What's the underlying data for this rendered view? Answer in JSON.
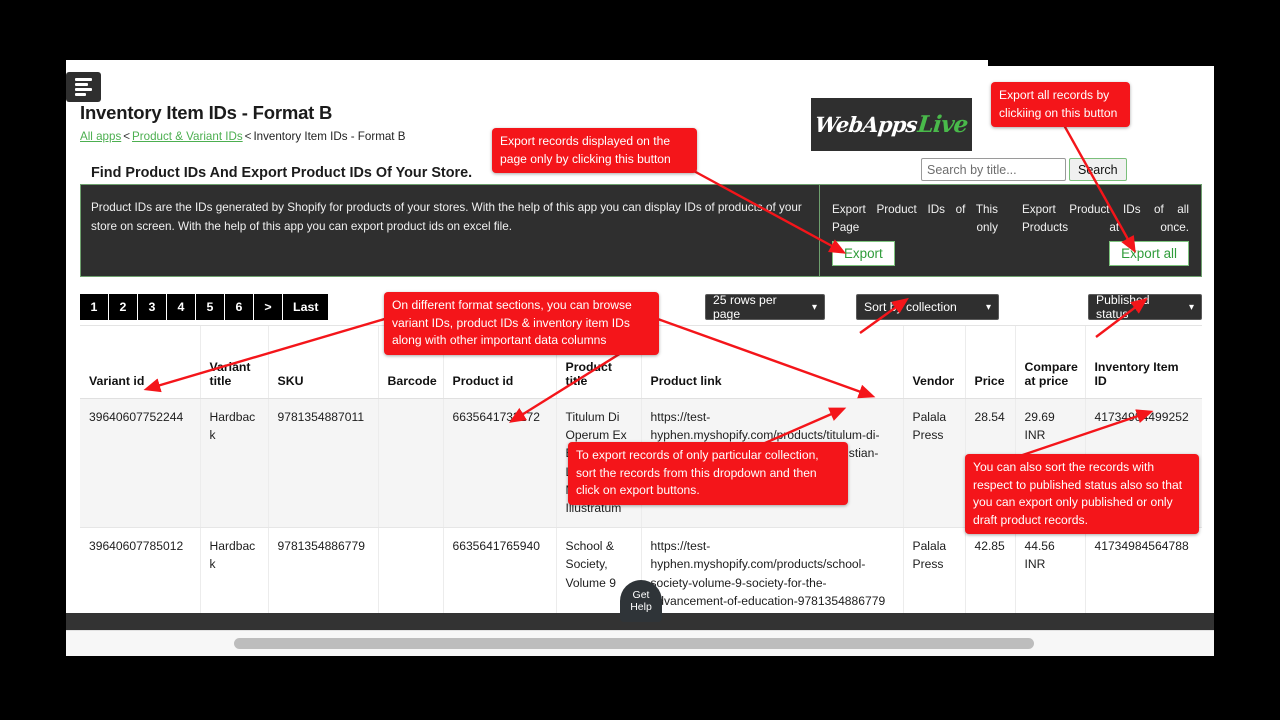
{
  "header": {
    "menu_icon": "hamburger-icon",
    "page_title": "Inventory Item IDs - Format B",
    "breadcrumb": {
      "all_apps": "All apps",
      "sep1": "<",
      "parent": "Product & Variant IDs",
      "sep2": "<",
      "current": "Inventory Item IDs - Format B"
    },
    "subheading": "Find Product IDs And Export Product IDs Of Your Store.",
    "logo": {
      "primary": "WebApps",
      "accent": "Live",
      "accent_color": "#49b94a"
    }
  },
  "search": {
    "placeholder": "Search by title...",
    "value": "",
    "button_label": "Search"
  },
  "banner": {
    "description": "Product IDs are the IDs generated by Shopify for products of your stores. With the help of this app you can display IDs of products of your store on screen. With the help of this app you can export product ids on excel file.",
    "export_page": {
      "caption": "Export Product IDs of This Page only",
      "button_label": "Export"
    },
    "export_all": {
      "caption": "Export Product IDs of all Products at once.",
      "button_label": "Export all"
    },
    "accent_color": "#6ea06e"
  },
  "toolbar": {
    "pages": [
      "1",
      "2",
      "3",
      "4",
      "5",
      "6",
      ">",
      "Last"
    ],
    "active_page": "1",
    "rows_per_page": "25 rows per page",
    "sort_by": "Sort by collection",
    "published_status": "Published status",
    "caret_icon": "chevron-down-icon"
  },
  "table": {
    "columns": [
      "Variant id",
      "Variant title",
      "SKU",
      "Barcode",
      "Product id",
      "Product title",
      "Product link",
      "Vendor",
      "Price",
      "Compare at price",
      "Inventory Item ID"
    ],
    "rows": [
      {
        "variant_id": "39640607752244",
        "variant_title": "Hardback",
        "sku": "9781354887011",
        "barcode": "",
        "product_id": "6635641733172",
        "product_title": "Titulum Di Operum Ex Elementis Legata Multifariam Illustratum",
        "product_link": "https://test-hyphen.myshopify.com/products/titulum-di-operum-ex-elementis-one-legata-christian-gebauer-9781354887011",
        "vendor": "Palala Press",
        "price": "28.54",
        "compare_at_price": "29.69 INR",
        "inventory_item_id": "41734984499252"
      },
      {
        "variant_id": "39640607785012",
        "variant_title": "Hardback",
        "sku": "9781354886779",
        "barcode": "",
        "product_id": "6635641765940",
        "product_title": "School & Society, Volume 9",
        "product_link": "https://test-hyphen.myshopify.com/products/school-society-volume-9-society-for-the-advancement-of-education-9781354886779",
        "vendor": "Palala Press",
        "price": "42.85",
        "compare_at_price": "44.56 INR",
        "inventory_item_id": "41734984564788"
      }
    ]
  },
  "get_help": {
    "line1": "Get",
    "line2": "Help"
  },
  "annotations": [
    {
      "id": "ann-export-page",
      "text": "Export records displayed on the page only by clicking this button"
    },
    {
      "id": "ann-export-all",
      "text": "Export all records by clickiing on this button"
    },
    {
      "id": "ann-formats",
      "text": "On different format sections, you can browse variant IDs, product IDs & inventory item IDs along with other important data columns"
    },
    {
      "id": "ann-collection",
      "text": "To export records of only particular collection, sort the records from this dropdown and then click on export buttons."
    },
    {
      "id": "ann-published",
      "text": "You can also sort the records with respect to published status also so that you can export only published or only draft product records."
    }
  ],
  "annotation_color": "#f4151a"
}
